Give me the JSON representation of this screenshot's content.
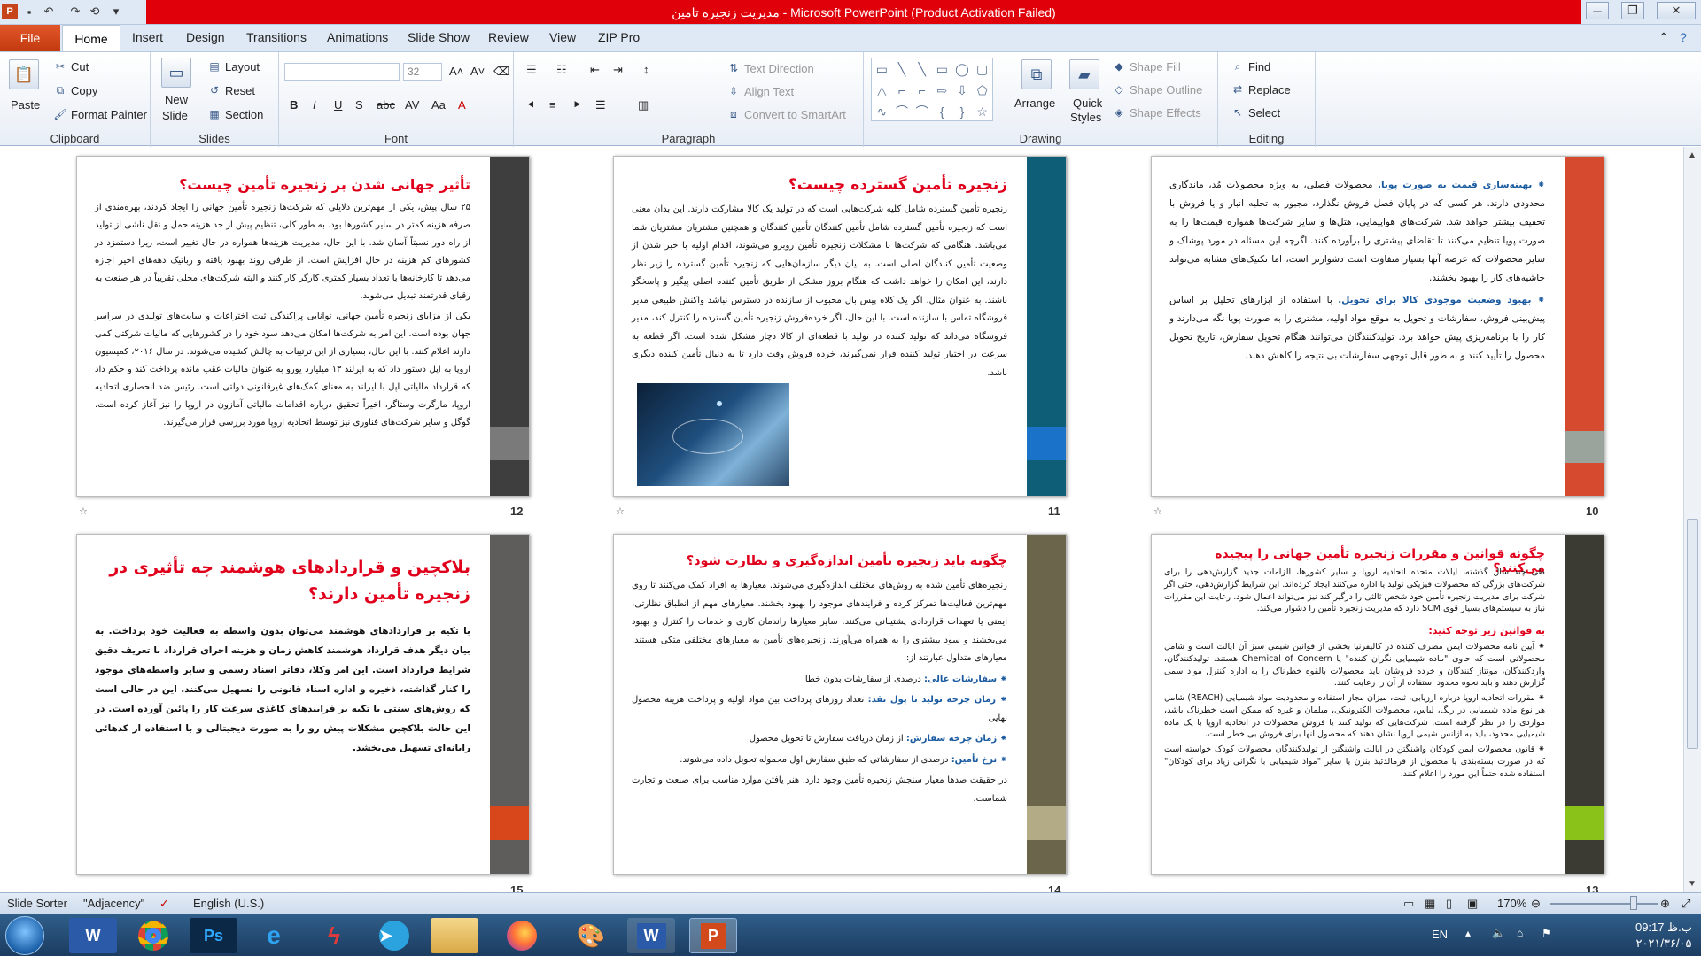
{
  "window": {
    "title": "مدیریت زنجیره تامین - Microsoft PowerPoint (Product Activation Failed)",
    "controls": [
      "─",
      "❐",
      "✕"
    ]
  },
  "tabs": {
    "file": "File",
    "items": [
      "Home",
      "Insert",
      "Design",
      "Transitions",
      "Animations",
      "Slide Show",
      "Review",
      "View",
      "ZIP Pro"
    ]
  },
  "ribbon": {
    "clipboard": {
      "label": "Clipboard",
      "paste": "Paste",
      "cut": "Cut",
      "copy": "Copy",
      "format_painter": "Format Painter"
    },
    "slides": {
      "label": "Slides",
      "new_slide": "New",
      "new_slide2": "Slide",
      "layout": "Layout",
      "reset": "Reset",
      "section": "Section"
    },
    "font": {
      "label": "Font",
      "size": "32"
    },
    "paragraph": {
      "label": "Paragraph",
      "text_direction": "Text Direction",
      "align_text": "Align Text",
      "convert_smartart": "Convert to SmartArt"
    },
    "drawing": {
      "label": "Drawing",
      "arrange": "Arrange",
      "quick_styles": "Quick",
      "quick_styles2": "Styles",
      "shape_fill": "Shape Fill",
      "shape_outline": "Shape Outline",
      "shape_effects": "Shape Effects"
    },
    "editing": {
      "label": "Editing",
      "find": "Find",
      "replace": "Replace",
      "select": "Select"
    }
  },
  "slides": [
    {
      "num": "10",
      "bullet1_head": "⁕ بهینه‌سازی قیمت به صورت پویا.",
      "bullet1_text": "محصولات فصلی، به ویژه محصولات مُد، ماندگاری محدودی دارند. هر کسی که در پایان فصل فروش نگذارد، مجبور به تخلیه انبار و یا فروش با تخفیف بیشتر خواهد شد. شرکت‌های هواپیمایی، هتل‌ها و سایر شرکت‌ها همواره قیمت‌ها را به صورت پویا تنظیم می‌کنند تا تقاضای پیشتری را برآورده کنند. اگرچه این مسئله در مورد پوشاک و سایر محصولات که عرضه آنها بسیار متفاوت است دشوارتر است، اما تکنیک‌های مشابه می‌تواند حاشیه‌های کار را بهبود بخشند.",
      "bullet2_head": "⁕ بهبود وضعیت موجودی کالا برای تحویل.",
      "bullet2_text": "با استفاده از ابزارهای تحلیل بر اساس پیش‌بینی فروش، سفارشات و تحویل به موقع مواد اولیه، مشتری را به صورت پویا نگه می‌دارند و کار را با برنامه‌ریزی پیش خواهد برد. تولیدکنندگان می‌توانند هنگام تحویل سفارش، تاریخ تحویل محصول را تأیید کنند و به طور قابل توجهی سفارشات بی نتیجه را کاهش دهند."
    },
    {
      "num": "11",
      "title": "زنجیره تأمین گسترده چیست؟",
      "body": "زنجیره تأمین گسترده شامل کلیه شرکت‌هایی است که در تولید یک کالا مشارکت دارند. این بدان معنی است که زنجیره تأمین گسترده شامل تأمین کنندگان تأمین کنندگان و همچنین مشتریان مشتریان شما می‌باشد. هنگامی که شرکت‌ها با مشکلات زنجیره تأمین روبرو می‌شوند، اقدام اولیه با خبر شدن از وضعیت تأمین کنندگان اصلی است. به بیان دیگر سازمان‌هایی که زنجیره تأمین گسترده را زیر نظر دارند، این امکان را خواهد داشت که هنگام بروز مشکل از طریق تأمین کننده اصلی پیگیر و پاسخگو باشند. به عنوان مثال، اگر یک کلاه پیس بال محبوب از سازنده در دسترس نباشد واکنش طبیعی مدیر فروشگاه تماس با سازنده است. با این حال، اگر خرده‌فروش زنجیره تأمین گسترده را کنترل کند، مدیر فروشگاه می‌داند که تولید کننده در تولید با قطعه‌ای از کالا دچار مشکل شده است. اگر قطعه به سرعت در اختیار تولید کننده قرار نمی‌گیرند، خرده فروش وقت دارد تا به دنبال تأمین کننده دیگری باشد."
    },
    {
      "num": "12",
      "title": "تأثیر جهانی شدن بر زنجیره تأمین چیست؟",
      "p1": "۲۵ سال پیش، یکی از مهم‌ترین دلایلی که شرکت‌ها زنجیره تأمین جهانی را ایجاد کردند، بهره‌مندی از صرفه هزینه کمتر در سایر کشورها بود. به طور کلی، تنظیم پیش از حد هزینه حمل و نقل ناشی از تولید از راه دور نسبتاً آسان شد. با این حال، مدیریت هزینه‌ها همواره در حال تغییر است، زیرا دستمزد در کشورهای کم هزینه در حال افزایش است. از طرفی روند بهبود یافته و رباتیک دهه‌های اخیر اجازه می‌دهد تا کارخانه‌ها با تعداد بسیار کمتری کارگر کار کنند و البته شرکت‌های محلی تقریباً در هر صنعت به رقبای قدرتمند تبدیل می‌شوند.",
      "p2": "یکی از مزایای زنجیره تأمین جهانی، توانایی پراکندگی ثبت اختراعات و سایت‌های تولیدی در سراسر جهان بوده است. این امر به شرکت‌ها امکان می‌دهد سود خود را در کشورهایی که مالیات شرکتی کمی دارند اعلام کنند. با این حال، بسیاری از این ترتیبات به چالش کشیده می‌شوند. در سال ۲۰۱۶، کمیسیون اروپا به اپل دستور داد که به ایرلند ۱۳ میلیارد یورو به عنوان مالیات عقب مانده پرداخت کند و حکم داد که قرارداد مالیاتی اپل با ایرلند به معنای کمک‌های غیرقانونی دولتی است. رئیس ضد انحصاری اتحادیه اروپا، مارگرت وستاگر، اخیراً تحقیق درباره اقدامات مالیاتی آمازون در اروپا را نیز آغاز کرده است. گوگل و سایر شرکت‌های فناوری نیز توسط اتحادیه اروپا مورد بررسی قرار می‌گیرند."
    },
    {
      "num": "13",
      "title": "چگونه قوانین و مقررات زنجیره تأمین جهانی را پیچیده می‌کنند؟",
      "intro": "طی چند سال گذشته، ایالات متحده اتحادیه اروپا و سایر کشورها، الزامات جدید گزارش‌دهی را برای شرکت‌های بزرگی که محصولات فیزیکی تولید یا اداره می‌کنند ایجاد کرده‌اند. این شرایط گزارش‌دهی، حتی اگر شرکت برای مدیریت زنجیره تأمین خود شخص ثالثی را درگیر کند نیز می‌تواند اعمال شود. رعایت این مقررات نیاز به سیستم‌های بسیار قوی SCM دارد که مدیریت زنجیره تأمین را دشوار می‌کند.",
      "subhead": "به قوانین زیر توجه کنید:",
      "b1": "⁕ آیین نامه محصولات ایمن مصرف کننده در کالیفرنیا بخشی از قوانین شیمی سبز آن ایالت است و شامل محصولاتی است که حاوی \"ماده شیمیایی نگران کننده\" یا Chemical of Concern هستند. تولیدکنندگان، واردکنندگان، مونتاژ کنندگان و خرده فروشان باید محصولات بالقوه خطرناک را به اداره کنترل مواد سمی گزارش دهند و باید نحوه محدود استفاده از آن را رعایت کنند.",
      "b2": "⁕ مقررات اتحادیه اروپا درباره ارزیابی، ثبت، میزان مجاز استفاده و محدودیت مواد شیمیایی (REACH) شامل هر نوع ماده شیمیایی در رنگ، لباس، محصولات الکترونیکی، مبلمان و غیره که ممکن است خطرناک باشد، مواردی را در نظر گرفته است. شرکت‌هایی که تولید کنند یا فروش محصولات در اتحادیه اروپا با یک ماده شیمیایی محدود، باید به آژانس شیمی اروپا نشان دهند که محصول آنها برای فروش بی خطر است.",
      "b3": "⁕ قانون محصولات ایمن کودکان واشنگتن در ایالت واشنگتن از تولیدکنندگان محصولات کودک خواسته است که در صورت بسته‌بندی یا محصول از فرمالدئید بنزن یا سایر \"مواد شیمیایی با نگرانی زیاد برای کودکان\" استفاده شده حتماً این مورد را اعلام کنند."
    },
    {
      "num": "14",
      "title": "چگونه باید زنجیره تأمین اندازه‌گیری و نظارت شود؟",
      "intro": "زنجیره‌های تأمین شده به روش‌های مختلف اندازه‌گیری می‌شوند. معیارها به افراد کمک می‌کنند تا روی مهم‌ترین فعالیت‌ها تمرکز کرده و فرایندهای موجود را بهبود بخشند. معیارهای مهم از انطباق نظارتی، ایمنی یا تعهدات قراردادی پشتیبانی می‌کنند. سایر معیارها راندمان کاری و خدمات را کنترل و بهبود می‌بخشند و سود بیشتری را به همراه می‌آورند. زنجیره‌های تأمین به معیارهای مختلفی متکی هستند. معیارهای متداول عبارتند از:",
      "m1_head": "⁕ سفارشات عالی:",
      "m1_text": "درصدی از سفارشات بدون خطا",
      "m2_head": "⁕ زمان چرخه تولید تا پول نقد:",
      "m2_text": "تعداد روزهای پرداخت بین مواد اولیه و پرداخت هزینه محصول نهایی",
      "m3_head": "⁕ زمان چرخه سفارش:",
      "m3_text": "از زمان دریافت سفارش تا تحویل محصول",
      "m4_head": "⁕ نرخ تأمین:",
      "m4_text": "درصدی از سفارشاتی که طبق سفارش اول محموله تحویل داده می‌شوند.",
      "outro": "در حقیقت صدها معیار سنجش زنجیره تأمین وجود دارد. هنر یافتن موارد مناسب برای صنعت و تجارت شماست."
    },
    {
      "num": "15",
      "title": "بلاکچین و قراردادهای هوشمند چه تأثیری در زنجیره تأمین دارند؟",
      "body": "با تکیه بر قراردادهای هوشمند می‌توان بدون واسطه به فعالیت خود پرداخت. به بیان دیگر هدف قرارداد هوشمند کاهش زمان و هزینه اجرای قرارداد با تعریف دقیق شرایط قرارداد است. این امر وکلا، دفاتر اسناد رسمی و سایر واسطه‌های موجود را کنار گذاشته، ذخیره و اداره اسناد قانونی را تسهیل می‌کنند. این در حالی است که روش‌های سنتی با تکیه بر فرایندهای کاغذی سرعت کار را پائین آورده است. در این حالت بلاکچین مشکلات پیش رو را به صورت دیجیتالی و با استفاده از کدهائی رایانه‌ای تسهیل می‌بخشد."
    }
  ],
  "status": {
    "view": "Slide Sorter",
    "theme": "\"Adjacency\"",
    "language": "English (U.S.)",
    "zoom": "170%"
  },
  "taskbar": {
    "lang": "EN",
    "time": "09:17 ب.ظ",
    "date": "۲۰۲۱/۳۶/۰۵"
  },
  "colors": {
    "accent_red": "#e0001b",
    "title_bar_red": "#e0000a",
    "file_tab": "#d24a1c"
  }
}
